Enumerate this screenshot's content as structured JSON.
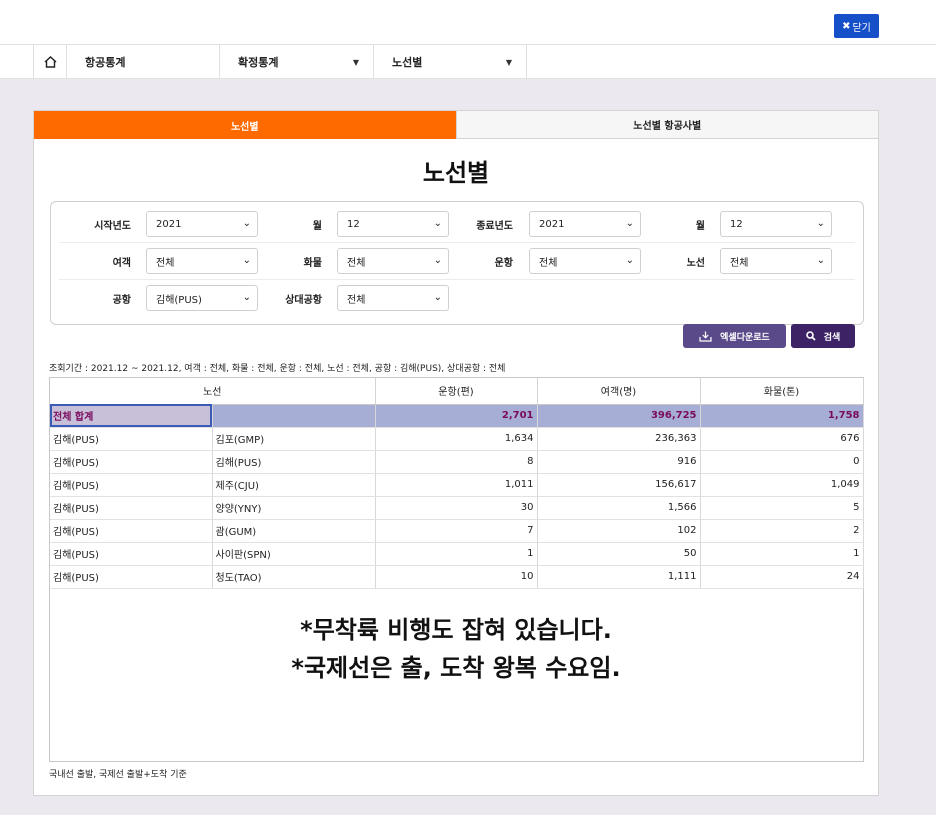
{
  "header": {
    "close_label": "닫기"
  },
  "nav": {
    "item1": "항공통계",
    "item2": "확정통계",
    "item3": "노선별"
  },
  "tabs": {
    "active": "노선별",
    "inactive": "노선별 항공사별"
  },
  "page_title": "노선별",
  "filters": {
    "start_year_label": "시작년도",
    "start_year": "2021",
    "start_month_label": "월",
    "start_month": "12",
    "end_year_label": "종료년도",
    "end_year": "2021",
    "end_month_label": "월",
    "end_month": "12",
    "passenger_label": "여객",
    "passenger": "전체",
    "cargo_label": "화물",
    "cargo": "전체",
    "flight_label": "운항",
    "flight": "전체",
    "route_label": "노선",
    "route": "전체",
    "airport_label": "공항",
    "airport": "김해(PUS)",
    "counterpart_label": "상대공항",
    "counterpart": "전체"
  },
  "buttons": {
    "excel": "엑셀다운로드",
    "search": "검색"
  },
  "query_info": "조회기간 : 2021.12 ~ 2021.12, 여객 : 전체, 화물 : 전체, 운항 : 전체, 노선 : 전체, 공항 : 김해(PUS), 상대공항 : 전체",
  "table": {
    "headers": {
      "route": "노선",
      "flights": "운항(편)",
      "passengers": "여객(명)",
      "cargo": "화물(톤)"
    },
    "total": {
      "label": "전체 합계",
      "flights": "2,701",
      "passengers": "396,725",
      "cargo": "1,758"
    },
    "rows": [
      {
        "from": "김해(PUS)",
        "to": "김포(GMP)",
        "flights": "1,634",
        "passengers": "236,363",
        "cargo": "676"
      },
      {
        "from": "김해(PUS)",
        "to": "김해(PUS)",
        "flights": "8",
        "passengers": "916",
        "cargo": "0"
      },
      {
        "from": "김해(PUS)",
        "to": "제주(CJU)",
        "flights": "1,011",
        "passengers": "156,617",
        "cargo": "1,049"
      },
      {
        "from": "김해(PUS)",
        "to": "양양(YNY)",
        "flights": "30",
        "passengers": "1,566",
        "cargo": "5"
      },
      {
        "from": "김해(PUS)",
        "to": "괌(GUM)",
        "flights": "7",
        "passengers": "102",
        "cargo": "2"
      },
      {
        "from": "김해(PUS)",
        "to": "사이판(SPN)",
        "flights": "1",
        "passengers": "50",
        "cargo": "1"
      },
      {
        "from": "김해(PUS)",
        "to": "청도(TAO)",
        "flights": "10",
        "passengers": "1,111",
        "cargo": "24"
      }
    ]
  },
  "overlay": {
    "line1": "*무착륙 비행도 잡혀 있습니다.",
    "line2": "*국제선은 출, 도착 왕복 수요임."
  },
  "footnote": "국내선 출발, 국제선 출발+도착 기준"
}
